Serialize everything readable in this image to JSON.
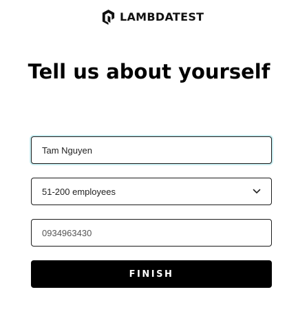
{
  "logo": {
    "icon": "lambdatest-logo-icon",
    "text": "LAMBDATEST"
  },
  "title": "Tell us about yourself",
  "form": {
    "name_value": "Tam Nguyen",
    "company_size": {
      "selected": "51-200 employees",
      "icon": "chevron-down-icon"
    },
    "phone_placeholder": "0934963430",
    "finish_label": "FINISH"
  },
  "colors": {
    "button_bg": "#000000",
    "focus_ring": "#c9eef2"
  }
}
